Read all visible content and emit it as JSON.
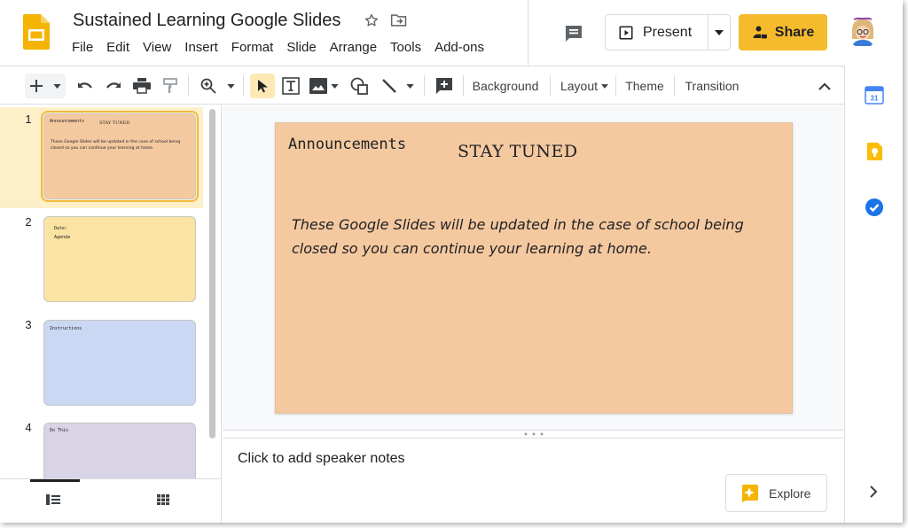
{
  "app": {
    "doc_title": "Sustained Learning Google Slides",
    "brand_color": "#f4b400",
    "accent_color": "#f6bb2c"
  },
  "menu": [
    "File",
    "Edit",
    "View",
    "Insert",
    "Format",
    "Slide",
    "Arrange",
    "Tools",
    "Add-ons"
  ],
  "header": {
    "present_label": "Present",
    "share_label": "Share"
  },
  "toolbar": {
    "background_label": "Background",
    "layout_label": "Layout",
    "theme_label": "Theme",
    "transition_label": "Transition"
  },
  "filmstrip": {
    "slides": [
      {
        "num": "1",
        "title": "Announcements",
        "extra": "STAY TUNED",
        "body": "These Google Slides will be updated in the case of school being closed so you can continue your learning at home.",
        "color": "#f5c9a0"
      },
      {
        "num": "2",
        "title": "Date:",
        "extra": "Agenda",
        "body": "",
        "color": "#fbe3a3"
      },
      {
        "num": "3",
        "title": "Instructions",
        "extra": "",
        "body": "",
        "color": "#cad8f3"
      },
      {
        "num": "4",
        "title": "Do This",
        "extra": "",
        "body": "",
        "color": "#d9d3e6"
      }
    ]
  },
  "slide": {
    "heading": "Announcements",
    "subheading": "STAY TUNED",
    "body": "These Google Slides will be updated in the case of school being closed so you can continue your learning at home.",
    "background": "#f5c9a0"
  },
  "notes": {
    "placeholder": "Click to add speaker notes"
  },
  "explore": {
    "label": "Explore"
  },
  "side_panel": {
    "icons": [
      "calendar-icon",
      "keep-icon",
      "tasks-icon"
    ],
    "calendar_day": "31"
  }
}
